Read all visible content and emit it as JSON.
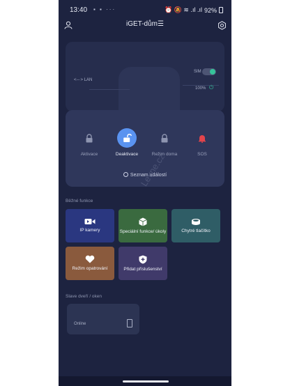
{
  "status_bar": {
    "time": "13:40",
    "left_icons": "▪ ▪ ···",
    "right_icons": "⏰ 🔕 ≋ .ıl .ıl",
    "battery": "92%"
  },
  "app_bar": {
    "title": "iGET-dům",
    "title_suffix": "☰"
  },
  "hub": {
    "lan_label": "<--·> LAN",
    "sim_label": "SIM",
    "battery_label": "100%",
    "sim_enabled": true
  },
  "modes": [
    {
      "label": "Aktivace",
      "icon": "lock-icon",
      "active": false
    },
    {
      "label": "Deaktivace",
      "icon": "unlock-icon",
      "active": true
    },
    {
      "label": "Režim doma",
      "icon": "home-lock-icon",
      "active": false
    },
    {
      "label": "SOS",
      "icon": "bell-icon",
      "active": false
    }
  ],
  "events_link": "Seznam událostí",
  "sections": {
    "common": "Běžné funkce",
    "rooms": "Slave dveří / oken"
  },
  "tiles": [
    {
      "label": "IP kamery",
      "icon": "camera-icon",
      "color": "#2a3780"
    },
    {
      "label": "Speciální funkce/ úkoly",
      "icon": "cube-icon",
      "color": "#3a6a3f"
    },
    {
      "label": "Chytré tlačítko",
      "icon": "button-icon",
      "color": "#2f5d66"
    },
    {
      "label": "Režim opatrování",
      "icon": "heart-icon",
      "color": "#8a5a3d"
    },
    {
      "label": "Přidat příslušenství",
      "icon": "shield-plus-icon",
      "color": "#403a6a"
    }
  ],
  "room": {
    "status": "Online"
  },
  "watermark": "Levne.cz",
  "colors": {
    "background": "#1d2340",
    "accent": "#5a93f0",
    "sos": "#e2444b",
    "green": "#36c39a"
  }
}
